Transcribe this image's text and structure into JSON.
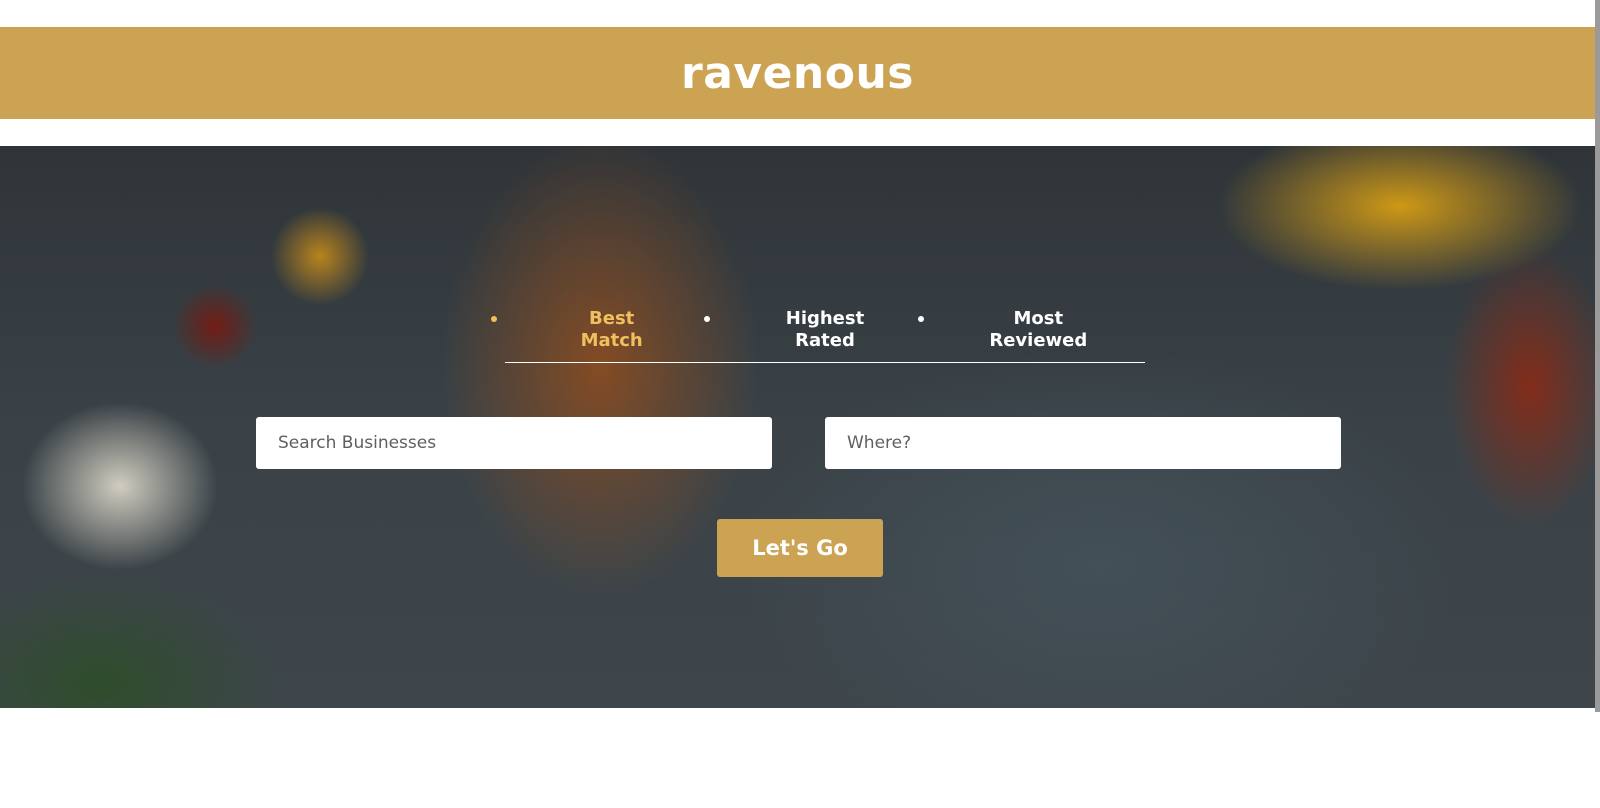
{
  "header": {
    "logo": "ravenous",
    "color": "#cca353"
  },
  "search_bar": {
    "sort_options": [
      {
        "label": "Best Match",
        "active": true
      },
      {
        "label": "Highest Rated",
        "active": false
      },
      {
        "label": "Most Reviewed",
        "active": false
      }
    ],
    "business_input": {
      "value": "",
      "placeholder": "Search Businesses"
    },
    "location_input": {
      "value": "",
      "placeholder": "Where?"
    },
    "submit_label": "Let's Go",
    "active_color": "#f0c060"
  }
}
